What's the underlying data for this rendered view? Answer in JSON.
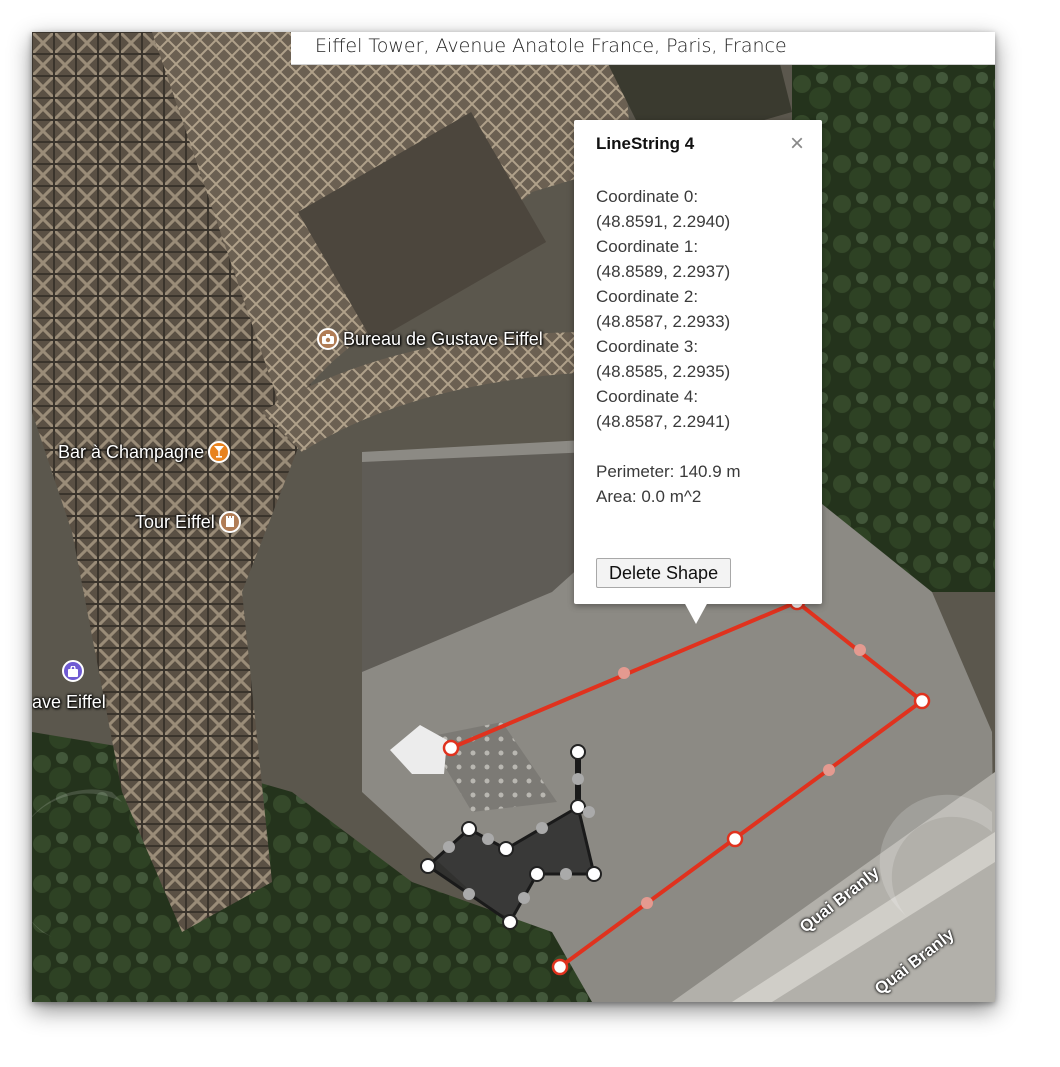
{
  "search": {
    "value": "Eiffel Tower, Avenue Anatole France, Paris, France"
  },
  "places": [
    {
      "label": "Bureau de Gustave Eiffel",
      "icon": "camera-icon"
    },
    {
      "label": "Bar à Champagne",
      "icon": "glass-icon"
    },
    {
      "label": "Tour Eiffel",
      "icon": "tower-icon"
    },
    {
      "label": "ave Eiffel",
      "icon": "shopping-bag-icon"
    }
  ],
  "roads": [
    "Quai Branly",
    "Quai Branly"
  ],
  "popup": {
    "title": "LineString 4",
    "close_symbol": "×",
    "coordinates": [
      {
        "label": "Coordinate 0:",
        "value": "(48.8591, 2.2940)"
      },
      {
        "label": "Coordinate 1:",
        "value": "(48.8589, 2.2937)"
      },
      {
        "label": "Coordinate 2:",
        "value": "(48.8587, 2.2933)"
      },
      {
        "label": "Coordinate 3:",
        "value": "(48.8585, 2.2935)"
      },
      {
        "label": "Coordinate 4:",
        "value": "(48.8587, 2.2941)"
      }
    ],
    "perimeter": "Perimeter: 140.9 m",
    "area": "Area: 0.0 m^2",
    "delete_label": "Delete Shape"
  },
  "colors": {
    "line": "#e0321e",
    "polygon_fill": "#2a2a2a",
    "poi_orange": "#e8821e",
    "poi_brown": "#b07c55",
    "poi_purple": "#6f5bd3"
  }
}
